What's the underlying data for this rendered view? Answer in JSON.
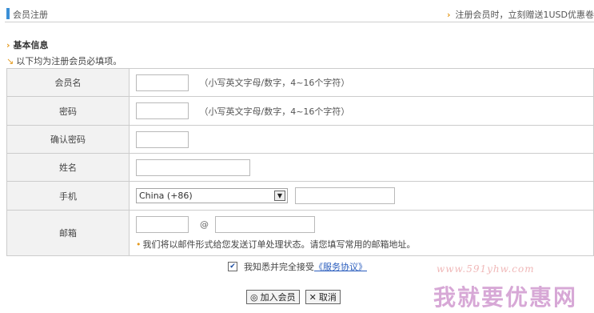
{
  "header": {
    "title": "会员注册",
    "promo": "注册会员时，立刻赠送1USD优惠卷"
  },
  "section": {
    "title": "基本信息",
    "required_note": "以下均为注册会员必填项。"
  },
  "form": {
    "member_name": {
      "label": "会员名",
      "value": "",
      "hint": "（小写英文字母/数字，4~16个字符）"
    },
    "password": {
      "label": "密码",
      "value": "",
      "hint": "（小写英文字母/数字，4~16个字符）"
    },
    "confirm_password": {
      "label": "确认密码",
      "value": ""
    },
    "full_name": {
      "label": "姓名",
      "value": ""
    },
    "mobile": {
      "label": "手机",
      "country_selected": "China (+86)",
      "value": ""
    },
    "email": {
      "label": "邮箱",
      "user": "",
      "at": "@",
      "domain": "",
      "note": "我们将以邮件形式给您发送订单处理状态。请您填写常用的邮箱地址。"
    }
  },
  "agreement": {
    "checked": true,
    "text": "我知悉并完全接受",
    "link": "《服务协议》"
  },
  "buttons": {
    "submit": "加入会员",
    "cancel": "取消"
  },
  "watermark": {
    "url": "www.591yhw.com",
    "text": "我就要优惠网"
  },
  "colors": {
    "accent": "#e59a1e",
    "header_marker": "#3b8fd6",
    "link": "#2a5dbd"
  }
}
